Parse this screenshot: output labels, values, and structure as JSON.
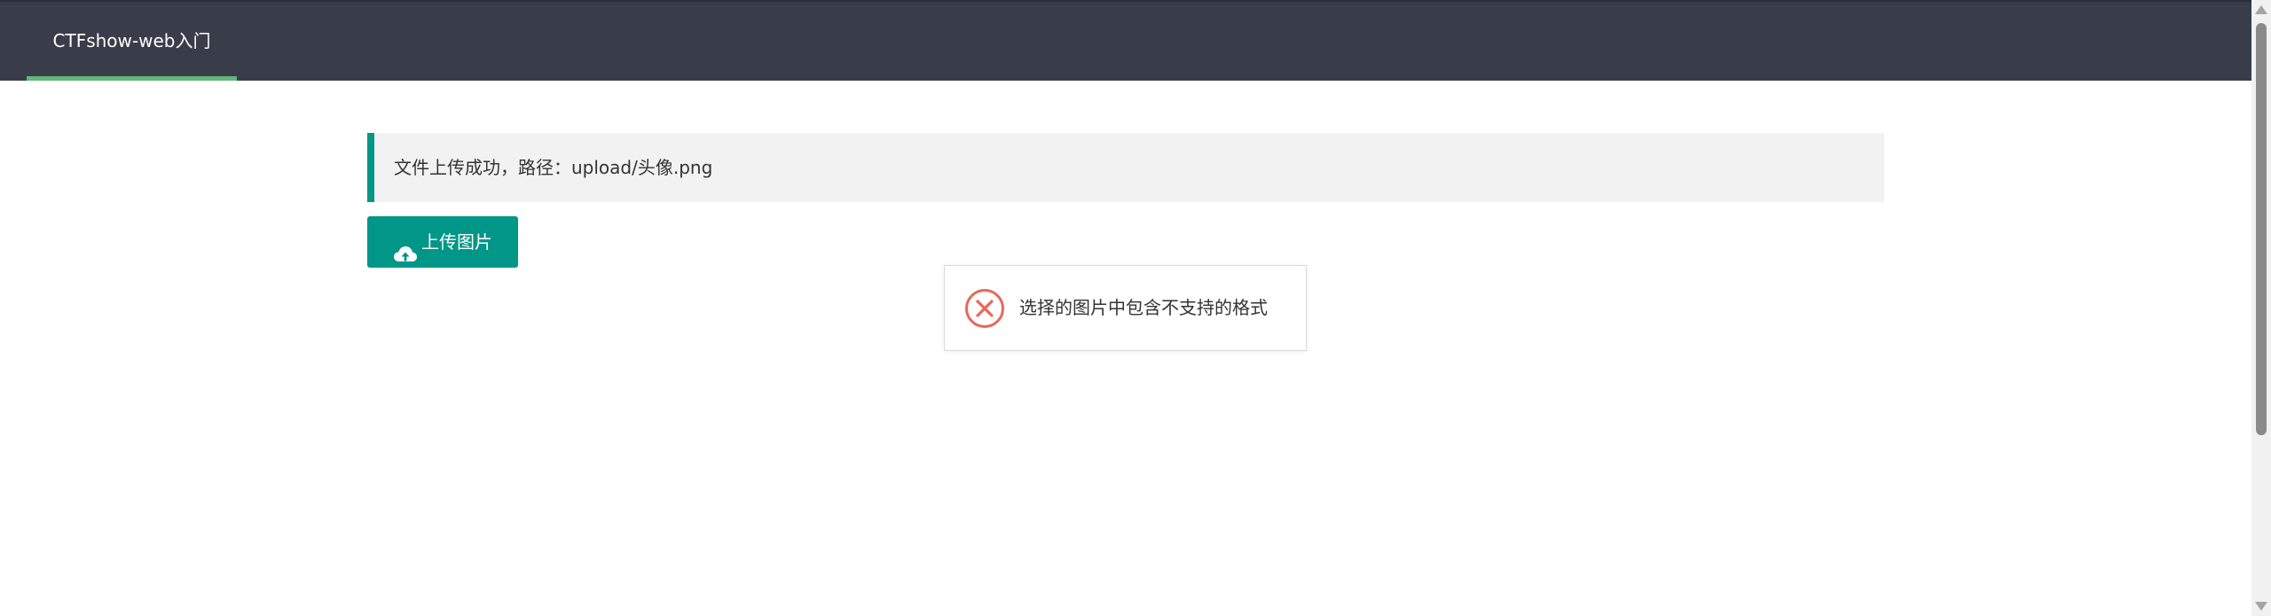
{
  "nav": {
    "tab_label": "CTFshow-web入门",
    "active_underline_color": "#5FB878",
    "background_color": "#393D49"
  },
  "notice": {
    "text": "文件上传成功，路径：upload/头像.png",
    "accent_color": "#009688"
  },
  "upload_button": {
    "icon": "cloud-upload-icon",
    "label": "上传图片",
    "color": "#009688"
  },
  "toast": {
    "icon": "error-circle-icon",
    "message": "选择的图片中包含不支持的格式",
    "icon_color": "#e8685a"
  }
}
